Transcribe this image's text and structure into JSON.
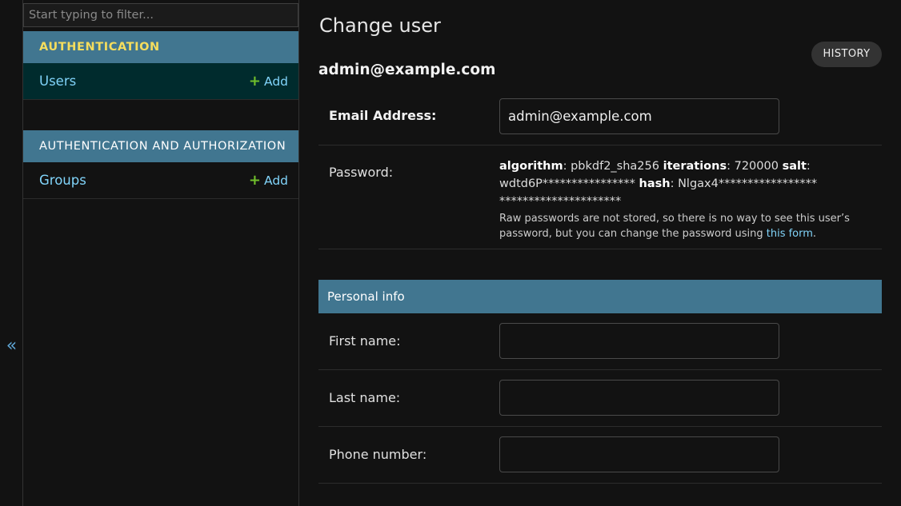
{
  "sidebar": {
    "filter_placeholder": "Start typing to filter...",
    "toggle_label": "«",
    "modules": [
      {
        "header": "AUTHENTICATION",
        "items": [
          {
            "label": "Users",
            "add_label": "Add",
            "selected": true
          }
        ]
      },
      {
        "header": "AUTHENTICATION AND AUTHORIZATION",
        "items": [
          {
            "label": "Groups",
            "add_label": "Add",
            "selected": false
          }
        ]
      }
    ]
  },
  "main": {
    "title": "Change user",
    "history_label": "HISTORY",
    "object_name": "admin@example.com",
    "email": {
      "label": "Email Address:",
      "value": "admin@example.com"
    },
    "password": {
      "label": "Password:",
      "algorithm_key": "algorithm",
      "algorithm_value": ": pbkdf2_sha256 ",
      "iterations_key": "iterations",
      "iterations_value": ": 720000 ",
      "salt_key": "salt",
      "salt_value": ": wdtd6P**************** ",
      "hash_key": "hash",
      "hash_value": ": Nlgax4**************************************",
      "help_text": "Raw passwords are not stored, so there is no way to see this user’s password, but you can change the password using ",
      "help_link": "this form",
      "help_end": "."
    },
    "personal_info": {
      "header": "Personal info",
      "first_name_label": "First name:",
      "first_name_value": "",
      "last_name_label": "Last name:",
      "last_name_value": "",
      "phone_label": "Phone number:",
      "phone_value": ""
    }
  },
  "colors": {
    "background": "#121212",
    "module_header": "#417690",
    "selected_row": "#002b2d",
    "link": "#81d4fa",
    "add_plus": "#70bf2b",
    "header_accent": "#f5dd5d"
  },
  "icons": {
    "add": "plus-icon",
    "toggle": "collapse-sidebar-icon"
  }
}
